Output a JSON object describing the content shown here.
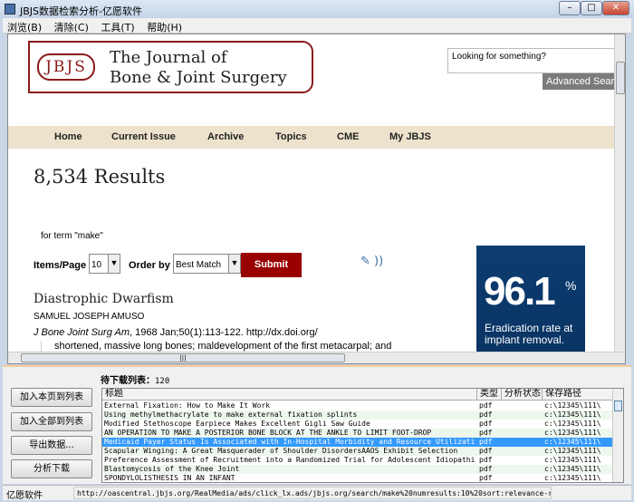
{
  "window": {
    "title": "JBJS数据检索分析-亿愿软件"
  },
  "menu": [
    "浏览(B)",
    "清除(C)",
    "工具(T)",
    "帮助(H)"
  ],
  "page": {
    "logo_mono": "JBJS",
    "logo_line1": "The Journal of",
    "logo_line2": "Bone & Joint Surgery",
    "search_placeholder": "Looking for something?",
    "advanced_search": "Advanced Search",
    "nav": [
      "Home",
      "Current Issue",
      "Archive",
      "Topics",
      "CME",
      "My JBJS"
    ],
    "results_count": "8,534 Results",
    "term": "for term \"make\"",
    "items_label": "Items/Page",
    "items_value": "10",
    "order_label": "Order by",
    "order_value": "Best Match",
    "submit": "Submit",
    "article": {
      "title": "Diastrophic Dwarfism",
      "author": "SAMUEL JOSEPH AMUSO",
      "journal": "J Bone Joint Surg Am",
      "cite": ", 1968 Jan;50(1):113-122. http://dx.doi.org/",
      "snippet": "shortened, massive long bones; maldevelopment of the first metacarpal; and"
    },
    "ad": {
      "value": "96.1",
      "pct": "%",
      "line1": "Eradication rate at",
      "line2": "implant removal."
    }
  },
  "panel": {
    "buttons": [
      "加入本页到列表",
      "加入全部到列表",
      "导出数据...",
      "分析下载"
    ],
    "queue_label": "待下载列表：",
    "queue_count": "120",
    "columns": [
      "标题",
      "类型",
      "分析状态",
      "保存路径"
    ],
    "rows": [
      {
        "title": "External Fixation: How to Make It Work",
        "type": "pdf",
        "status": "",
        "path": "c:\\12345\\111\\"
      },
      {
        "title": "Using methylmethacrylate to make external fixation splints",
        "type": "pdf",
        "status": "",
        "path": "c:\\12345\\111\\"
      },
      {
        "title": "Modified Stethoscope Earpiece Makes Excellent Gigli Saw Guide",
        "type": "pdf",
        "status": "",
        "path": "c:\\12345\\111\\"
      },
      {
        "title": "AN OPERATION TO MAKE A POSTERIOR BONE BLOCK AT THE ANKLE TO LIMIT FOOT-DROP",
        "type": "pdf",
        "status": "",
        "path": "c:\\12345\\111\\"
      },
      {
        "title": "Medicaid Payer Status Is Associated with In-Hospital Morbidity and Resource Utilization...",
        "type": "pdf",
        "status": "",
        "path": "c:\\12345\\111\\"
      },
      {
        "title": "Scapular Winging: A Great Masquerader of Shoulder DisordersAAOS Exhibit Selection",
        "type": "pdf",
        "status": "",
        "path": "c:\\12345\\111\\"
      },
      {
        "title": "Preference Assessment of Recruitment into a Randomized Trial for Adolescent Idiopathic ...",
        "type": "pdf",
        "status": "",
        "path": "c:\\12345\\111\\"
      },
      {
        "title": "Blastomycosis of the Knee Joint",
        "type": "pdf",
        "status": "",
        "path": "c:\\12345\\111\\"
      },
      {
        "title": "SPONDYLOLISTHESIS IN AN INFANT",
        "type": "pdf",
        "status": "",
        "path": "c:\\12345\\111\\"
      }
    ],
    "selected_row": 4
  },
  "status": {
    "left": "亿愿软件",
    "url": "http://oascentral.jbjs.org/RealMedia/ads/click_lx.ads/jbjs.org/search/make%20numresults:10%20sort:relevance-rank/L15"
  }
}
